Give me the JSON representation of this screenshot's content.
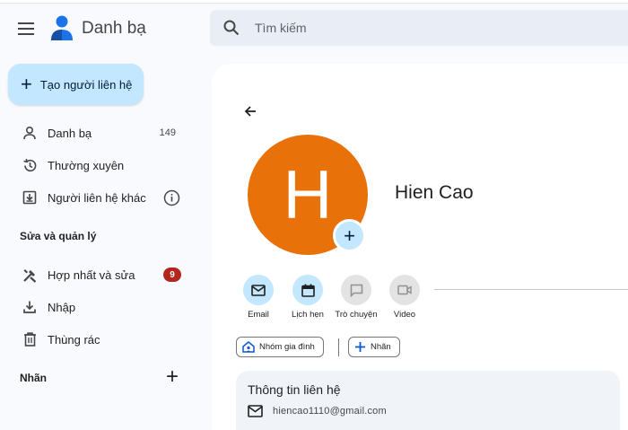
{
  "app": {
    "title": "Danh bạ"
  },
  "search": {
    "placeholder": "Tìm kiếm"
  },
  "sidebar": {
    "create_label": "Tạo người liên hệ",
    "items": [
      {
        "label": "Danh bạ",
        "count": "149",
        "icon": "person-icon"
      },
      {
        "label": "Thường xuyên",
        "icon": "history-icon"
      },
      {
        "label": "Người liên hệ khác",
        "icon": "download-box-icon",
        "trailing_icon": "info-icon"
      }
    ],
    "section_title": "Sửa và quản lý",
    "manage_items": [
      {
        "label": "Hợp nhất và sửa",
        "badge": "9",
        "icon": "merge-tools-icon"
      },
      {
        "label": "Nhập",
        "icon": "import-icon"
      },
      {
        "label": "Thùng rác",
        "icon": "trash-icon"
      }
    ],
    "labels_title": "Nhãn"
  },
  "contact": {
    "initial": "H",
    "name": "Hien Cao",
    "avatar_color": "#e8710a",
    "actions": [
      {
        "label": "Email",
        "enabled": true,
        "icon": "mail-icon"
      },
      {
        "label": "Lịch hẹn",
        "enabled": true,
        "icon": "calendar-icon"
      },
      {
        "label": "Trò chuyện",
        "enabled": false,
        "icon": "chat-icon"
      },
      {
        "label": "Video",
        "enabled": false,
        "icon": "video-icon"
      }
    ],
    "chips": [
      {
        "label": "Nhóm gia đình",
        "icon": "home-group-icon"
      },
      {
        "label": "Nhãn",
        "icon": "plus-icon"
      }
    ],
    "info_title": "Thông tin liên hệ",
    "email": "hiencao1110@gmail.com"
  },
  "colors": {
    "accent": "#c2e7ff",
    "badge": "#b3261e",
    "background": "#f8fafd"
  }
}
